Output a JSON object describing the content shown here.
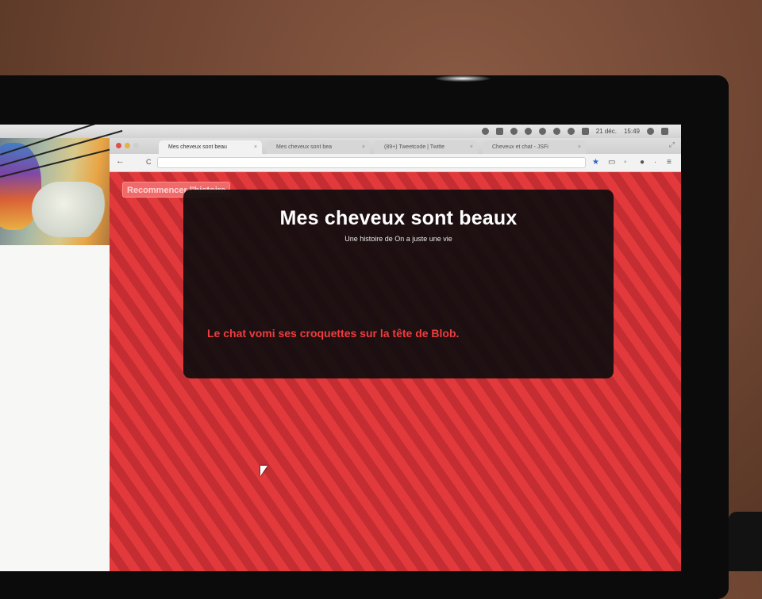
{
  "menubar": {
    "date": "21 déc.",
    "time": "15:49"
  },
  "browser": {
    "tabs": [
      {
        "label": "Mes cheveux sont beau",
        "close": "×",
        "active": true
      },
      {
        "label": "Mes cheveux sont bea",
        "close": "×",
        "active": false
      },
      {
        "label": "(89+) Tweetcode | Twitte",
        "close": "×",
        "active": false
      },
      {
        "label": "Cheveux et chat - JSFi",
        "close": "×",
        "active": false
      }
    ],
    "back_glyph": "←",
    "reload_glyph": "C"
  },
  "page": {
    "restart_label": "Recommencer l'histoire",
    "title": "Mes cheveux sont beaux",
    "subtitle": "Une histoire de On a juste une vie",
    "story_text": "Le chat vomi ses croquettes sur la tête de Blob."
  },
  "colors": {
    "stripe_light": "#e23a3c",
    "stripe_dark": "#c42d31",
    "panel": "#120e0f",
    "story_text": "#f03c3e",
    "button": "#f06a6a"
  }
}
